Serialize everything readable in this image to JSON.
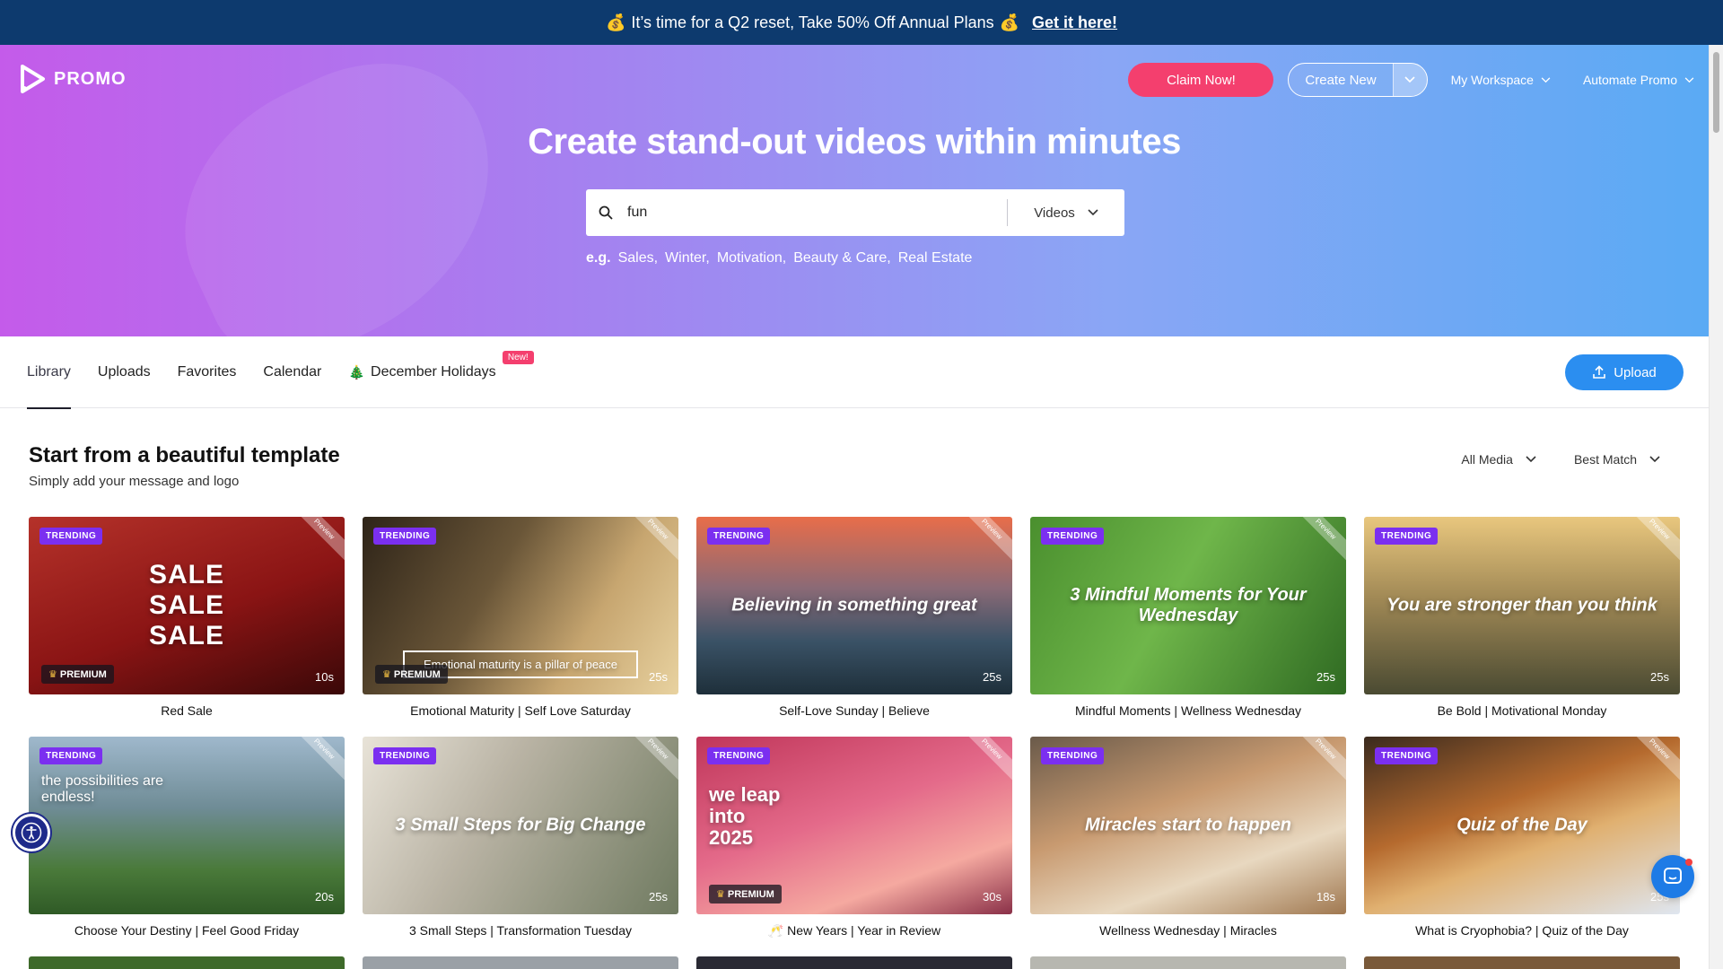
{
  "banner": {
    "emoji_left": "💰",
    "message": "It’s time for a Q2 reset, Take 50% Off Annual Plans",
    "emoji_right": "💰",
    "cta": "Get it here!"
  },
  "header": {
    "logo_text": "PROMO",
    "claim": "Claim Now!",
    "create": "Create New",
    "workspace": "My Workspace",
    "automate": "Automate Promo"
  },
  "hero": {
    "title": "Create stand-out videos within minutes",
    "search_value": "fun",
    "search_type": "Videos",
    "examples_label": "e.g.",
    "examples": [
      "Sales,",
      "Winter,",
      "Motivation,",
      "Beauty & Care,",
      "Real Estate"
    ]
  },
  "tabs": [
    {
      "label": "Library"
    },
    {
      "label": "Uploads"
    },
    {
      "label": "Favorites"
    },
    {
      "label": "Calendar"
    },
    {
      "label": "December Holidays",
      "badge": "New!",
      "emoji": "🎄"
    }
  ],
  "upload_label": "Upload",
  "section": {
    "title": "Start from a beautiful template",
    "subtitle": "Simply add your message and logo",
    "filter_media": "All Media",
    "filter_sort": "Best Match"
  },
  "common": {
    "badge": "TRENDING",
    "premium": "PREMIUM",
    "corner": "Preview"
  },
  "cards": [
    {
      "name": "Red Sale",
      "duration": "10s",
      "premium": true,
      "overlay": "SALE\nSALE\nSALE",
      "bg": "linear-gradient(160deg,#b5322a 0%,#8a1414 55%,#3a0808 100%)"
    },
    {
      "name": "Emotional Maturity | Self Love Saturday",
      "duration": "25s",
      "premium": true,
      "overlay": "Emotional maturity is a pillar of peace",
      "bg": "linear-gradient(120deg,#2e2418 0%,#6a5638 40%,#c7a670 70%,#e8d2a0 100%)"
    },
    {
      "name": "Self-Love Sunday | Believe",
      "duration": "25s",
      "premium": false,
      "overlay": "Believing in something great",
      "bg": "linear-gradient(180deg,#e86d4a 0%,#8b6a76 40%,#3a5266 70%,#1e2f3a 100%)"
    },
    {
      "name": "Mindful Moments | Wellness Wednesday",
      "duration": "25s",
      "premium": false,
      "overlay": "3 Mindful Moments for Your Wednesday",
      "bg": "linear-gradient(120deg,#4a8f2e 0%,#6fb64a 45%,#2f6a22 100%)"
    },
    {
      "name": "Be Bold | Motivational Monday",
      "duration": "25s",
      "premium": false,
      "overlay": "You are stronger than you think",
      "bg": "linear-gradient(180deg,#e9c77e 0%,#a28a56 45%,#4a4a32 100%)"
    },
    {
      "name": "Choose Your Destiny | Feel Good Friday",
      "duration": "20s",
      "premium": false,
      "overlay": "the possibilities are endless!",
      "bg": "linear-gradient(180deg,#9fb8cc 0%,#6f8c96 40%,#4a7a3a 75%,#2f5a26 100%)"
    },
    {
      "name": "3 Small Steps | Transformation Tuesday",
      "duration": "25s",
      "premium": false,
      "overlay": "3 Small Steps for Big Change",
      "bg": "linear-gradient(120deg,#e8e3d8 0%,#b9b3a4 40%,#6f7a60 100%)"
    },
    {
      "name": "New Years | Year in Review",
      "duration": "30s",
      "premium": true,
      "overlay": "we leap into 2025",
      "emoji": "🥂",
      "bg": "linear-gradient(160deg,#c0365a 0%,#e46a8a 45%,#f5a9a0 75%,#8a3048 100%)"
    },
    {
      "name": "Wellness Wednesday | Miracles",
      "duration": "18s",
      "premium": false,
      "overlay": "Miracles start to happen",
      "bg": "linear-gradient(160deg,#6a5a4a 0%,#c89a70 40%,#e8d8c0 70%,#a07850 100%)"
    },
    {
      "name": "What is Cryophobia? | Quiz of the Day",
      "duration": "25s",
      "premium": false,
      "overlay": "Quiz of the Day",
      "bg": "linear-gradient(160deg,#3a2a1e 0%,#b56a2e 40%,#e0b070 60%,#dfe6f0 100%)"
    }
  ],
  "colors": {
    "banner_bg": "#0d3a6e",
    "claim": "#f43f6e",
    "upload": "#2b8ef0",
    "trending": "#7b2ff0"
  }
}
